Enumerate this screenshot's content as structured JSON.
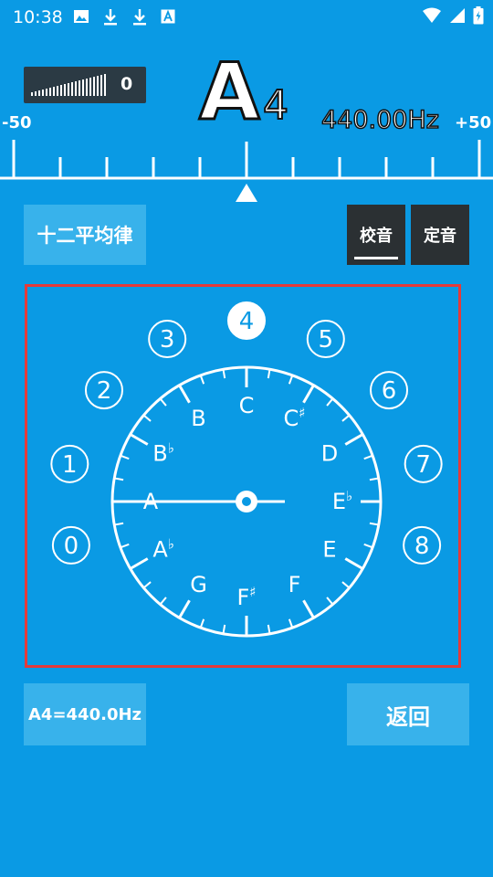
{
  "status_bar": {
    "time": "10:38"
  },
  "level_meter": {
    "value": "0"
  },
  "note": {
    "letter": "A",
    "octave": "4",
    "frequency": "440.00Hz"
  },
  "scale": {
    "min": "-50",
    "max": "+50"
  },
  "buttons": {
    "temperament": "十二平均律",
    "tune": "校音",
    "fixed": "定音",
    "reference": "A4=440.0Hz",
    "back": "返回"
  },
  "dial": {
    "octaves": [
      "0",
      "1",
      "2",
      "3",
      "4",
      "5",
      "6",
      "7",
      "8"
    ],
    "selected_octave": "4",
    "notes": [
      {
        "letter": "C",
        "accidental": ""
      },
      {
        "letter": "C",
        "accidental": "♯"
      },
      {
        "letter": "D",
        "accidental": ""
      },
      {
        "letter": "E",
        "accidental": "♭"
      },
      {
        "letter": "E",
        "accidental": ""
      },
      {
        "letter": "F",
        "accidental": ""
      },
      {
        "letter": "F",
        "accidental": "♯"
      },
      {
        "letter": "G",
        "accidental": ""
      },
      {
        "letter": "A",
        "accidental": "♭"
      },
      {
        "letter": "A",
        "accidental": ""
      },
      {
        "letter": "B",
        "accidental": "♭"
      },
      {
        "letter": "B",
        "accidental": ""
      }
    ]
  },
  "colors": {
    "background": "#0a9ae4",
    "button": "#38b2eb",
    "dark": "#2b3033",
    "highlight": "#e53a3a"
  }
}
